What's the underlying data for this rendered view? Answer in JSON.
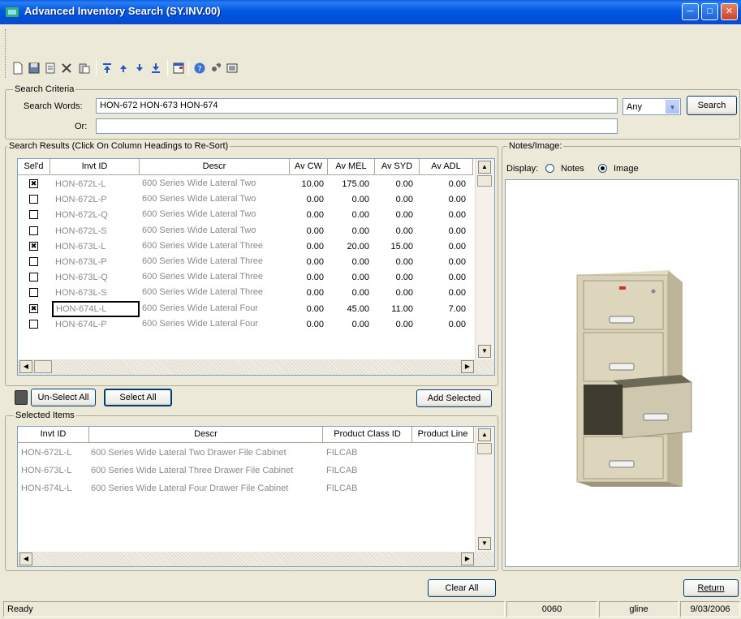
{
  "window": {
    "title": "Advanced Inventory Search (SY.INV.00)"
  },
  "toolbar": {
    "icons": [
      "new-icon",
      "save-icon",
      "copy-icon",
      "delete-icon",
      "paste-icon",
      "first-icon",
      "previous-icon",
      "next-icon",
      "last-icon",
      "window-icon",
      "help-icon",
      "tools-icon",
      "screen-icon"
    ]
  },
  "search_criteria": {
    "legend": "Search Criteria",
    "words_label": "Search Words:",
    "words_value": "HON-672 HON-673 HON-674",
    "or_label": "Or:",
    "or_value": "",
    "match_mode": "Any",
    "search_button": "Search"
  },
  "results": {
    "legend": "Search Results (Click On Column Headings to Re-Sort)",
    "columns": [
      "Sel'd",
      "Invt ID",
      "Descr",
      "Av CW",
      "Av MEL",
      "Av SYD",
      "Av ADL"
    ],
    "rows": [
      {
        "selected": true,
        "invt_id": "HON-672L-L",
        "descr": "600 Series Wide Lateral Two",
        "cw": "10.00",
        "mel": "175.00",
        "syd": "0.00",
        "adl": "0.00"
      },
      {
        "selected": false,
        "invt_id": "HON-672L-P",
        "descr": "600 Series Wide Lateral Two",
        "cw": "0.00",
        "mel": "0.00",
        "syd": "0.00",
        "adl": "0.00"
      },
      {
        "selected": false,
        "invt_id": "HON-672L-Q",
        "descr": "600 Series Wide Lateral Two",
        "cw": "0.00",
        "mel": "0.00",
        "syd": "0.00",
        "adl": "0.00"
      },
      {
        "selected": false,
        "invt_id": "HON-672L-S",
        "descr": "600 Series Wide Lateral Two",
        "cw": "0.00",
        "mel": "0.00",
        "syd": "0.00",
        "adl": "0.00"
      },
      {
        "selected": true,
        "invt_id": "HON-673L-L",
        "descr": "600 Series Wide Lateral Three",
        "cw": "0.00",
        "mel": "20.00",
        "syd": "15.00",
        "adl": "0.00"
      },
      {
        "selected": false,
        "invt_id": "HON-673L-P",
        "descr": "600 Series Wide Lateral Three",
        "cw": "0.00",
        "mel": "0.00",
        "syd": "0.00",
        "adl": "0.00"
      },
      {
        "selected": false,
        "invt_id": "HON-673L-Q",
        "descr": "600 Series Wide Lateral Three",
        "cw": "0.00",
        "mel": "0.00",
        "syd": "0.00",
        "adl": "0.00"
      },
      {
        "selected": false,
        "invt_id": "HON-673L-S",
        "descr": "600 Series Wide Lateral Three",
        "cw": "0.00",
        "mel": "0.00",
        "syd": "0.00",
        "adl": "0.00"
      },
      {
        "selected": true,
        "invt_id": "HON-674L-L",
        "descr": "600 Series Wide Lateral Four",
        "cw": "0.00",
        "mel": "45.00",
        "syd": "11.00",
        "adl": "7.00"
      },
      {
        "selected": false,
        "invt_id": "HON-674L-P",
        "descr": "600 Series Wide Lateral Four",
        "cw": "0.00",
        "mel": "0.00",
        "syd": "0.00",
        "adl": "0.00"
      }
    ],
    "unselect_all": "Un-Select All",
    "select_all": "Select All",
    "add_selected": "Add Selected"
  },
  "selected_items": {
    "legend": "Selected Items",
    "columns": [
      "Invt ID",
      "Descr",
      "Product Class ID",
      "Product Line"
    ],
    "rows": [
      {
        "invt_id": "HON-672L-L",
        "descr": "600 Series Wide Lateral Two Drawer File Cabinet",
        "class": "FILCAB"
      },
      {
        "invt_id": "HON-673L-L",
        "descr": "600 Series Wide Lateral Three Drawer File Cabinet",
        "class": "FILCAB"
      },
      {
        "invt_id": "HON-674L-L",
        "descr": "600 Series Wide Lateral Four Drawer File Cabinet",
        "class": "FILCAB"
      }
    ],
    "clear_all": "Clear All"
  },
  "notes_image": {
    "legend": "Notes/Image:",
    "display_label": "Display:",
    "notes_option": "Notes",
    "image_option": "Image",
    "selected": "image"
  },
  "footer": {
    "return_button": "Return"
  },
  "statusbar": {
    "message": "Ready",
    "company": "0060",
    "user": "gline",
    "date": "9/03/2006"
  },
  "colors": {
    "titlebar": "#0058e2",
    "window_bg": "#ece9d8",
    "grey_text": "#8a8a8a",
    "cabinet": "#d9d2b8"
  }
}
